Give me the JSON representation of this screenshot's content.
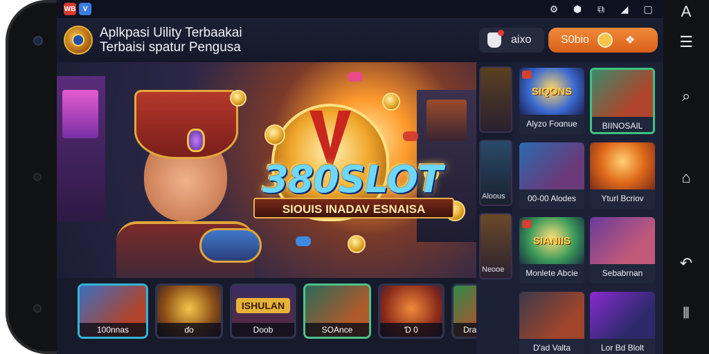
{
  "statusbar": {
    "app_icons": [
      "app-red-icon",
      "app-blue-icon"
    ],
    "app_labels": [
      "WB",
      "V"
    ],
    "right_icons": [
      "settings-icon",
      "location-icon",
      "cast-icon",
      "signal-icon",
      "window-icon",
      "font-icon"
    ],
    "right_glyphs": [
      "⚙",
      "⬢",
      "⧉",
      "◢",
      "▢",
      "A"
    ]
  },
  "header": {
    "title_line1": "Aplkpasi Uility Terbaakai",
    "title_line2": "Terbaisi spatur Pengusa",
    "notif_label": "aixo",
    "action_label": "S0bio"
  },
  "hero": {
    "logo_text": "380SLOT",
    "logo_sub": "SIOUIS INADAV ESNAISA"
  },
  "thumbs": [
    {
      "caption": "100nnas"
    },
    {
      "caption": "ɗo"
    },
    {
      "caption": "Doob",
      "art_text": "ISHULAN"
    },
    {
      "caption": "SOAnce"
    },
    {
      "caption": "Ɗ 0"
    },
    {
      "caption": "Dra SADU Aeyo"
    }
  ],
  "peek": [
    {
      "label": ""
    },
    {
      "label": "Aloous"
    },
    {
      "label": "Neooe"
    }
  ],
  "tiles": [
    {
      "label": "Alyzo Foɑnue",
      "art": "SIQONS"
    },
    {
      "label": "BIINOSAIL",
      "art": ""
    },
    {
      "label": "00-00 Alodes",
      "art": ""
    },
    {
      "label": "Yturl Bcriov",
      "art": ""
    },
    {
      "label": "Monlete Abcie",
      "art": "SIANIIS"
    },
    {
      "label": "Sebabrnan",
      "art": ""
    },
    {
      "label": "D'ad Valta",
      "art": ""
    },
    {
      "label": "Lor Bd Blolt",
      "art": ""
    }
  ],
  "navbar": {
    "icons": [
      "menu-icon",
      "search-icon",
      "home-icon",
      "back-icon",
      "recents-icon"
    ],
    "glyphs": [
      "☰",
      "⌕",
      "⌂",
      "↶",
      "⦀"
    ]
  },
  "colors": {
    "accent_orange": "#e0701f",
    "selection_green": "#3cc47e",
    "selection_cyan": "#33b6d6",
    "background": "#161a2a"
  }
}
